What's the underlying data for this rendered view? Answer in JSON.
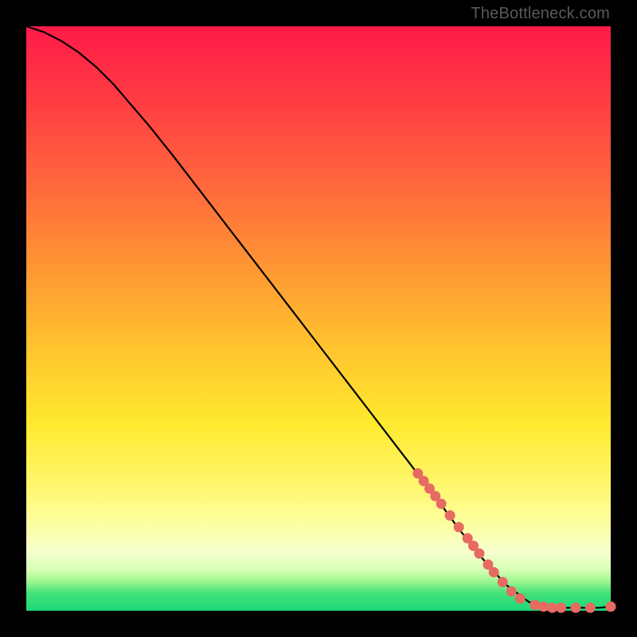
{
  "watermark": "TheBottleneck.com",
  "colors": {
    "line": "#000000",
    "marker": "#e76a63"
  },
  "chart_data": {
    "type": "line",
    "title": "",
    "xlabel": "",
    "ylabel": "",
    "xlim": [
      0,
      100
    ],
    "ylim": [
      0,
      100
    ],
    "grid": false,
    "legend": false,
    "series": [
      {
        "name": "curve",
        "x": [
          0,
          3,
          6,
          9,
          12,
          15,
          18,
          21,
          25,
          30,
          35,
          40,
          45,
          50,
          55,
          60,
          65,
          70,
          74,
          78,
          82,
          86,
          90,
          94,
          98,
          100
        ],
        "y": [
          100,
          99,
          97.5,
          95.5,
          93,
          90,
          86.5,
          83,
          78,
          71.5,
          65,
          58.5,
          52,
          45.5,
          39,
          32.5,
          26,
          19.5,
          14,
          9,
          4.5,
          1.5,
          0.5,
          0.5,
          0.5,
          0.7
        ]
      }
    ],
    "markers": [
      {
        "x": 67.0,
        "y": 23.5
      },
      {
        "x": 68.0,
        "y": 22.2
      },
      {
        "x": 69.0,
        "y": 20.9
      },
      {
        "x": 70.0,
        "y": 19.6
      },
      {
        "x": 71.0,
        "y": 18.3
      },
      {
        "x": 72.5,
        "y": 16.3
      },
      {
        "x": 74.0,
        "y": 14.3
      },
      {
        "x": 75.5,
        "y": 12.4
      },
      {
        "x": 76.5,
        "y": 11.1
      },
      {
        "x": 77.5,
        "y": 9.8
      },
      {
        "x": 79.0,
        "y": 7.9
      },
      {
        "x": 80.0,
        "y": 6.6
      },
      {
        "x": 81.5,
        "y": 4.9
      },
      {
        "x": 83.0,
        "y": 3.3
      },
      {
        "x": 84.5,
        "y": 2.1
      },
      {
        "x": 87.0,
        "y": 1.0
      },
      {
        "x": 88.5,
        "y": 0.7
      },
      {
        "x": 90.0,
        "y": 0.5
      },
      {
        "x": 91.5,
        "y": 0.5
      },
      {
        "x": 94.0,
        "y": 0.5
      },
      {
        "x": 96.5,
        "y": 0.5
      },
      {
        "x": 100.0,
        "y": 0.7
      }
    ]
  }
}
